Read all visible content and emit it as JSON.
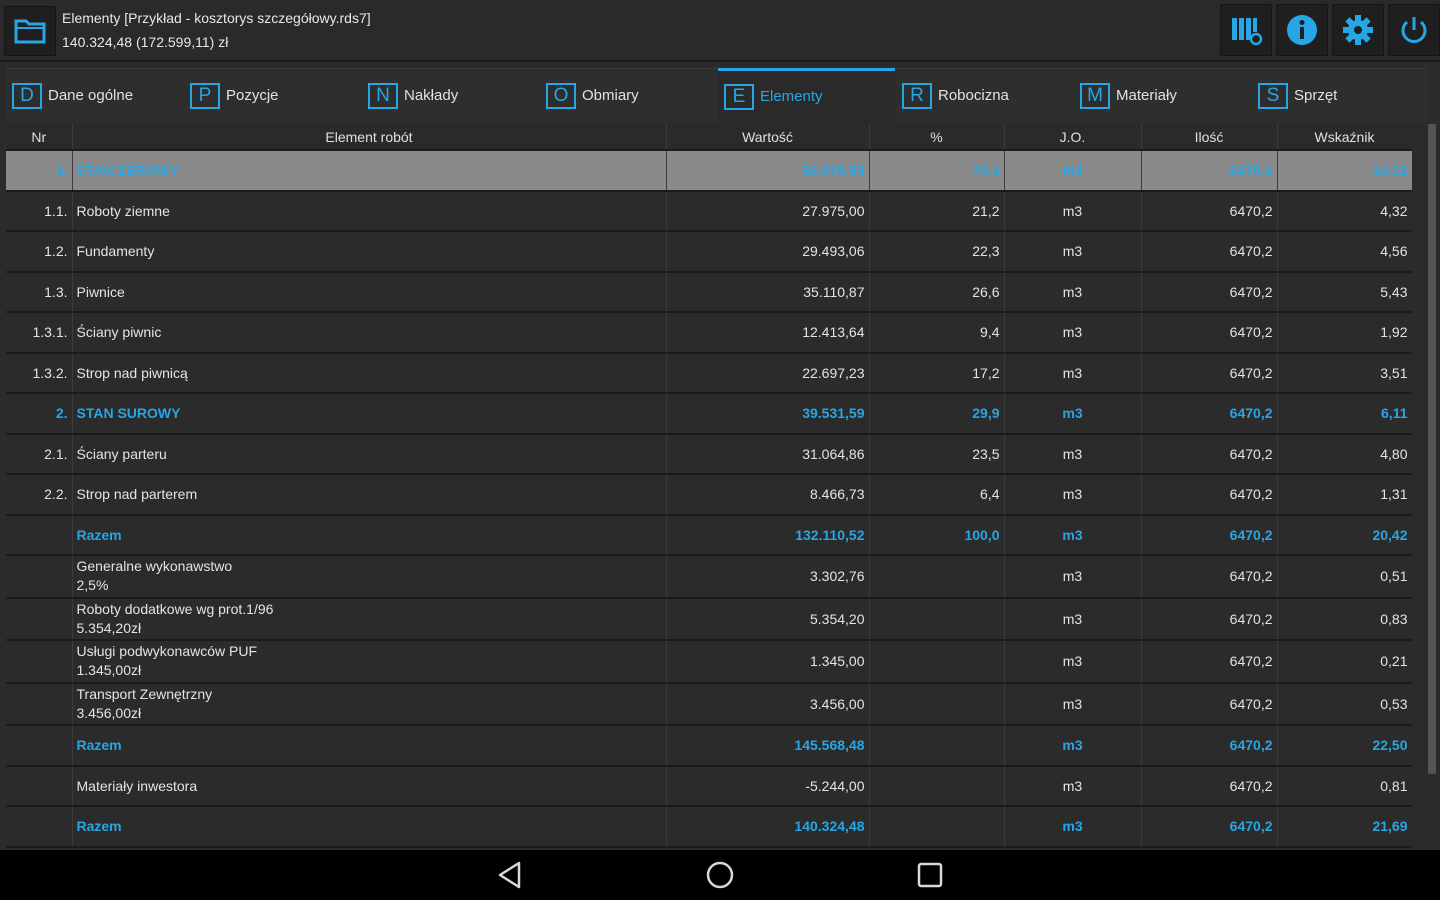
{
  "window": {
    "title": "Elementy [Przykład - kosztorys szczegółowy.rds7]",
    "subtitle": "140.324,48 (172.599,11) zł"
  },
  "icons": {
    "folder": "folder-icon",
    "columns": "columns-settings-icon",
    "info": "info-icon",
    "settings": "gear-icon",
    "power": "power-icon"
  },
  "colors": {
    "accent": "#27a6e5",
    "selected_row": "#8a8a8a",
    "background": "#2b2b2b"
  },
  "tabs": [
    {
      "key": "D",
      "label": "Dane ogólne"
    },
    {
      "key": "P",
      "label": "Pozycje"
    },
    {
      "key": "N",
      "label": "Nakłady"
    },
    {
      "key": "O",
      "label": "Obmiary"
    },
    {
      "key": "E",
      "label": "Elementy"
    },
    {
      "key": "R",
      "label": "Robocizna"
    },
    {
      "key": "M",
      "label": "Materiały"
    },
    {
      "key": "S",
      "label": "Sprzęt"
    }
  ],
  "table": {
    "headers": [
      "Nr",
      "Element robót",
      "Wartość",
      "%",
      "J.O.",
      "Ilość",
      "Wskaźnik"
    ],
    "rows": [
      {
        "nr": "1.",
        "name": "STAN ZEROWY",
        "sub": "",
        "value": "92.578,93",
        "pct": "70,1",
        "unit": "m3",
        "qty": "6470,2",
        "ind": "14,31"
      },
      {
        "nr": "1.1.",
        "name": "Roboty ziemne",
        "sub": "",
        "value": "27.975,00",
        "pct": "21,2",
        "unit": "m3",
        "qty": "6470,2",
        "ind": "4,32"
      },
      {
        "nr": "1.2.",
        "name": "Fundamenty",
        "sub": "",
        "value": "29.493,06",
        "pct": "22,3",
        "unit": "m3",
        "qty": "6470,2",
        "ind": "4,56"
      },
      {
        "nr": "1.3.",
        "name": "Piwnice",
        "sub": "",
        "value": "35.110,87",
        "pct": "26,6",
        "unit": "m3",
        "qty": "6470,2",
        "ind": "5,43"
      },
      {
        "nr": "1.3.1.",
        "name": "Ściany piwnic",
        "sub": "",
        "value": "12.413,64",
        "pct": "9,4",
        "unit": "m3",
        "qty": "6470,2",
        "ind": "1,92"
      },
      {
        "nr": "1.3.2.",
        "name": "Strop nad piwnicą",
        "sub": "",
        "value": "22.697,23",
        "pct": "17,2",
        "unit": "m3",
        "qty": "6470,2",
        "ind": "3,51"
      },
      {
        "nr": "2.",
        "name": "STAN SUROWY",
        "sub": "",
        "value": "39.531,59",
        "pct": "29,9",
        "unit": "m3",
        "qty": "6470,2",
        "ind": "6,11"
      },
      {
        "nr": "2.1.",
        "name": "Ściany parteru",
        "sub": "",
        "value": "31.064,86",
        "pct": "23,5",
        "unit": "m3",
        "qty": "6470,2",
        "ind": "4,80"
      },
      {
        "nr": "2.2.",
        "name": "Strop nad parterem",
        "sub": "",
        "value": "8.466,73",
        "pct": "6,4",
        "unit": "m3",
        "qty": "6470,2",
        "ind": "1,31"
      },
      {
        "nr": "",
        "name": "Razem",
        "sub": "",
        "value": "132.110,52",
        "pct": "100,0",
        "unit": "m3",
        "qty": "6470,2",
        "ind": "20,42"
      },
      {
        "nr": "",
        "name": "Generalne wykonawstwo",
        "sub": "2,5%",
        "value": "3.302,76",
        "pct": "",
        "unit": "m3",
        "qty": "6470,2",
        "ind": "0,51"
      },
      {
        "nr": "",
        "name": "Roboty dodatkowe wg prot.1/96",
        "sub": "5.354,20zł",
        "value": "5.354,20",
        "pct": "",
        "unit": "m3",
        "qty": "6470,2",
        "ind": "0,83"
      },
      {
        "nr": "",
        "name": "Usługi podwykonawców PUF",
        "sub": "1.345,00zł",
        "value": "1.345,00",
        "pct": "",
        "unit": "m3",
        "qty": "6470,2",
        "ind": "0,21"
      },
      {
        "nr": "",
        "name": "Transport Zewnętrzny",
        "sub": "3.456,00zł",
        "value": "3.456,00",
        "pct": "",
        "unit": "m3",
        "qty": "6470,2",
        "ind": "0,53"
      },
      {
        "nr": "",
        "name": "Razem",
        "sub": "",
        "value": "145.568,48",
        "pct": "",
        "unit": "m3",
        "qty": "6470,2",
        "ind": "22,50"
      },
      {
        "nr": "",
        "name": "Materiały inwestora",
        "sub": "",
        "value": "-5.244,00",
        "pct": "",
        "unit": "m3",
        "qty": "6470,2",
        "ind": "0,81"
      },
      {
        "nr": "",
        "name": "Razem",
        "sub": "",
        "value": "140.324,48",
        "pct": "",
        "unit": "m3",
        "qty": "6470,2",
        "ind": "21,69"
      }
    ]
  },
  "navbar": {
    "back": "back-triangle-icon",
    "home": "home-circle-icon",
    "recent": "recent-apps-square-icon"
  }
}
